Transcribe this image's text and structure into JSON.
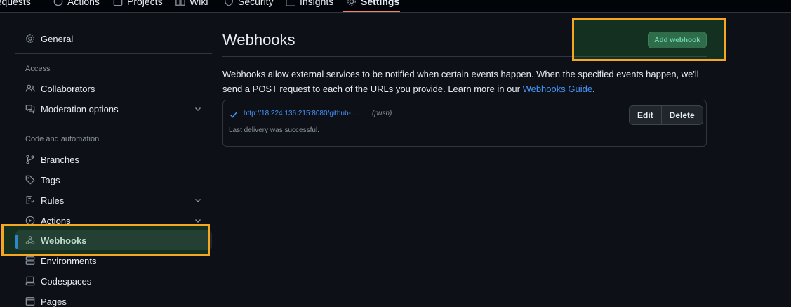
{
  "topnav": {
    "tabs": [
      {
        "label": "requests",
        "icon": ""
      },
      {
        "label": "Actions",
        "icon": "play-icon"
      },
      {
        "label": "Projects",
        "icon": "table-icon"
      },
      {
        "label": "Wiki",
        "icon": "book-icon"
      },
      {
        "label": "Security",
        "icon": "shield-icon"
      },
      {
        "label": "Insights",
        "icon": "graph-icon"
      },
      {
        "label": "Settings",
        "icon": "gear-icon",
        "active": true
      }
    ]
  },
  "sidebar": {
    "general": "General",
    "access_heading": "Access",
    "collaborators": "Collaborators",
    "moderation": "Moderation options",
    "code_heading": "Code and automation",
    "branches": "Branches",
    "tags": "Tags",
    "rules": "Rules",
    "actions": "Actions",
    "webhooks": "Webhooks",
    "environments": "Environments",
    "codespaces": "Codespaces",
    "pages": "Pages"
  },
  "main": {
    "title": "Webhooks",
    "add_button": "Add webhook",
    "description": "Webhooks allow external services to be notified when certain events happen. When the specified events happen, we'll send a POST request to each of the URLs you provide. Learn more in our ",
    "guide_link": "Webhooks Guide",
    "description_end": ".",
    "webhook": {
      "url": "http://18.224.136.215:8080/github-...",
      "events": "(push)",
      "status": "Last delivery was successful.",
      "edit_label": "Edit",
      "delete_label": "Delete"
    }
  },
  "colors": {
    "accent_blue": "#4493f8",
    "highlight_orange": "#f5a623",
    "add_button_bg": "#2f5e4c",
    "selected_bar": "#2f81f7"
  }
}
